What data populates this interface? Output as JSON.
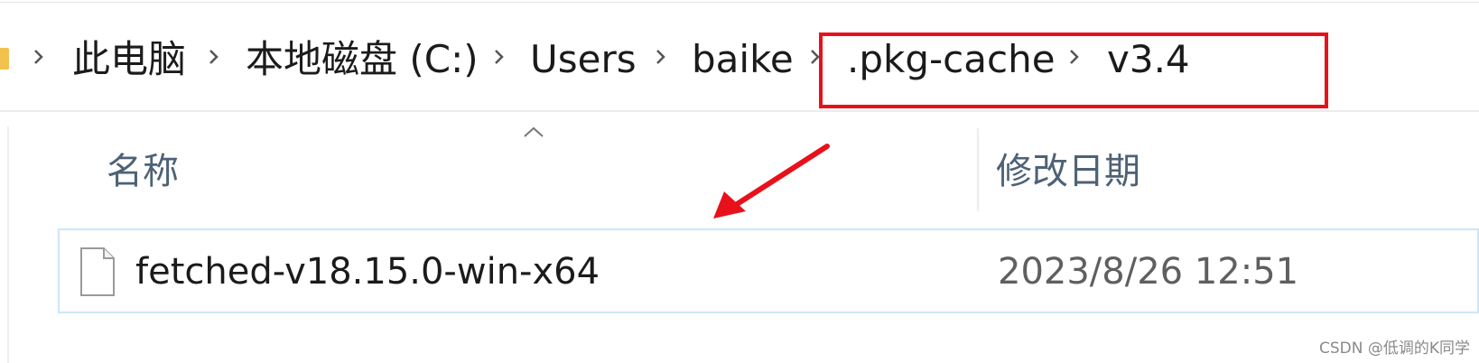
{
  "breadcrumb": {
    "items": [
      "此电脑",
      "本地磁盘 (C:)",
      "Users",
      "baike",
      ".pkg-cache",
      "v3.4"
    ]
  },
  "file_list": {
    "columns": [
      "名称",
      "修改日期"
    ],
    "rows": [
      {
        "name": "fetched-v18.15.0-win-x64",
        "date": "2023/8/26 12:51"
      }
    ]
  },
  "annotation": {
    "highlight_color": "#e8111b",
    "arrow_color": "#e8111b"
  },
  "watermark": "CSDN @低调的K同学"
}
